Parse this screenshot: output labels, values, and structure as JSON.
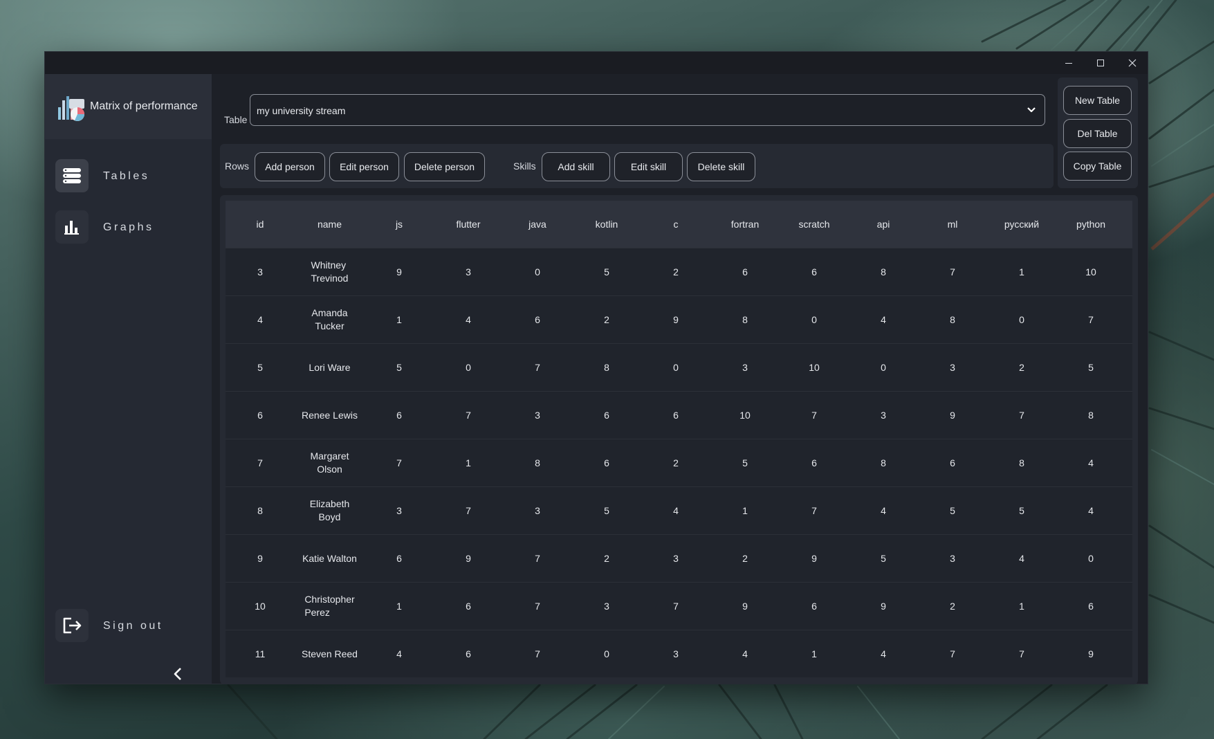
{
  "window": {
    "minimize_icon": "minimize-icon",
    "maximize_icon": "maximize-icon",
    "close_icon": "close-icon"
  },
  "sidebar": {
    "brand_title": "Matrix of performance",
    "brand_icon": "chart-logo-icon",
    "items": [
      {
        "label": "Tables",
        "icon": "table-list-icon",
        "active": true
      },
      {
        "label": "Graphs",
        "icon": "bar-chart-icon",
        "active": false
      }
    ],
    "sign_out": {
      "label": "Sign out",
      "icon": "sign-out-icon"
    },
    "collapse_icon": "chevron-left-icon"
  },
  "toolbar": {
    "table_label": "Table",
    "table_value": "my university stream",
    "rows_label": "Rows",
    "skills_label": "Skills",
    "add_person": "Add person",
    "edit_person": "Edit person",
    "delete_person": "Delete person",
    "add_skill": "Add skill",
    "edit_skill": "Edit skill",
    "delete_skill": "Delete skill",
    "new_table": "New Table",
    "del_table": "Del Table",
    "copy_table": "Copy Table"
  },
  "table": {
    "columns": [
      "id",
      "name",
      "js",
      "flutter",
      "java",
      "kotlin",
      "c",
      "fortran",
      "scratch",
      "api",
      "ml",
      "русский",
      "python"
    ],
    "rows": [
      {
        "id": "3",
        "name": [
          "Whitney",
          "Trevinod"
        ],
        "scores": [
          "9",
          "3",
          "0",
          "5",
          "2",
          "6",
          "6",
          "8",
          "7",
          "1",
          "10"
        ]
      },
      {
        "id": "4",
        "name": [
          "Amanda Tucker"
        ],
        "scores": [
          "1",
          "4",
          "6",
          "2",
          "9",
          "8",
          "0",
          "4",
          "8",
          "0",
          "7"
        ]
      },
      {
        "id": "5",
        "name": [
          "Lori Ware"
        ],
        "scores": [
          "5",
          "0",
          "7",
          "8",
          "0",
          "3",
          "10",
          "0",
          "3",
          "2",
          "5"
        ]
      },
      {
        "id": "6",
        "name": [
          "Renee Lewis"
        ],
        "scores": [
          "6",
          "7",
          "3",
          "6",
          "6",
          "10",
          "7",
          "3",
          "9",
          "7",
          "8"
        ]
      },
      {
        "id": "7",
        "name": [
          "Margaret Olson"
        ],
        "scores": [
          "7",
          "1",
          "8",
          "6",
          "2",
          "5",
          "6",
          "8",
          "6",
          "8",
          "4"
        ]
      },
      {
        "id": "8",
        "name": [
          "Elizabeth Boyd"
        ],
        "scores": [
          "3",
          "7",
          "3",
          "5",
          "4",
          "1",
          "7",
          "4",
          "5",
          "5",
          "4"
        ]
      },
      {
        "id": "9",
        "name": [
          "Katie Walton"
        ],
        "scores": [
          "6",
          "9",
          "7",
          "2",
          "3",
          "2",
          "9",
          "5",
          "3",
          "4",
          "0"
        ]
      },
      {
        "id": "10",
        "name": [
          "Christopher",
          "Perez"
        ],
        "scores": [
          "1",
          "6",
          "7",
          "3",
          "7",
          "9",
          "6",
          "9",
          "2",
          "1",
          "6"
        ]
      },
      {
        "id": "11",
        "name": [
          "Steven Reed"
        ],
        "scores": [
          "4",
          "6",
          "7",
          "0",
          "3",
          "4",
          "1",
          "4",
          "7",
          "7",
          "9"
        ]
      }
    ]
  }
}
